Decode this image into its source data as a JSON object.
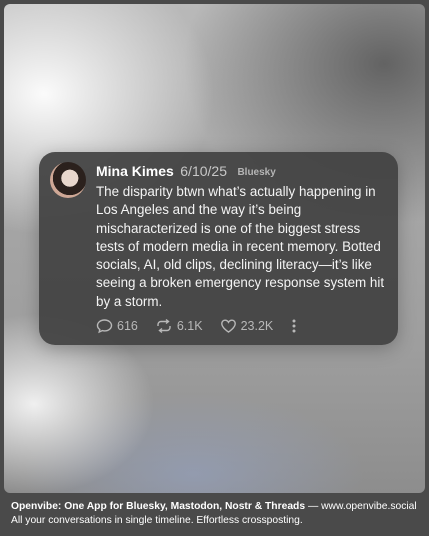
{
  "post": {
    "author": "Mina Kimes",
    "date": "6/10/25",
    "source": "Bluesky",
    "text": "The disparity btwn what’s actually happening in Los Angeles and the way it’s being mischaracterized is one of the biggest stress tests of modern media in recent memory. Botted socials, AI, old clips, declining literacy—it’s like seeing a broken emergency response system hit by a storm.",
    "replies": "616",
    "reposts": "6.1K",
    "likes": "23.2K"
  },
  "footer": {
    "headline": "Openvibe: One App for Bluesky, Mastodon, Nostr & Threads",
    "separator": " — ",
    "url": "www.openvibe.social",
    "tagline": "All your conversations in single timeline. Effortless crossposting."
  },
  "icons": {
    "reply": "speech-bubble-icon",
    "repost": "repost-arrows-icon",
    "like": "heart-icon",
    "more": "vertical-ellipsis-icon"
  },
  "colors": {
    "card": "#424242",
    "text": "#f4f4f4",
    "meta": "#b8b8b8"
  }
}
